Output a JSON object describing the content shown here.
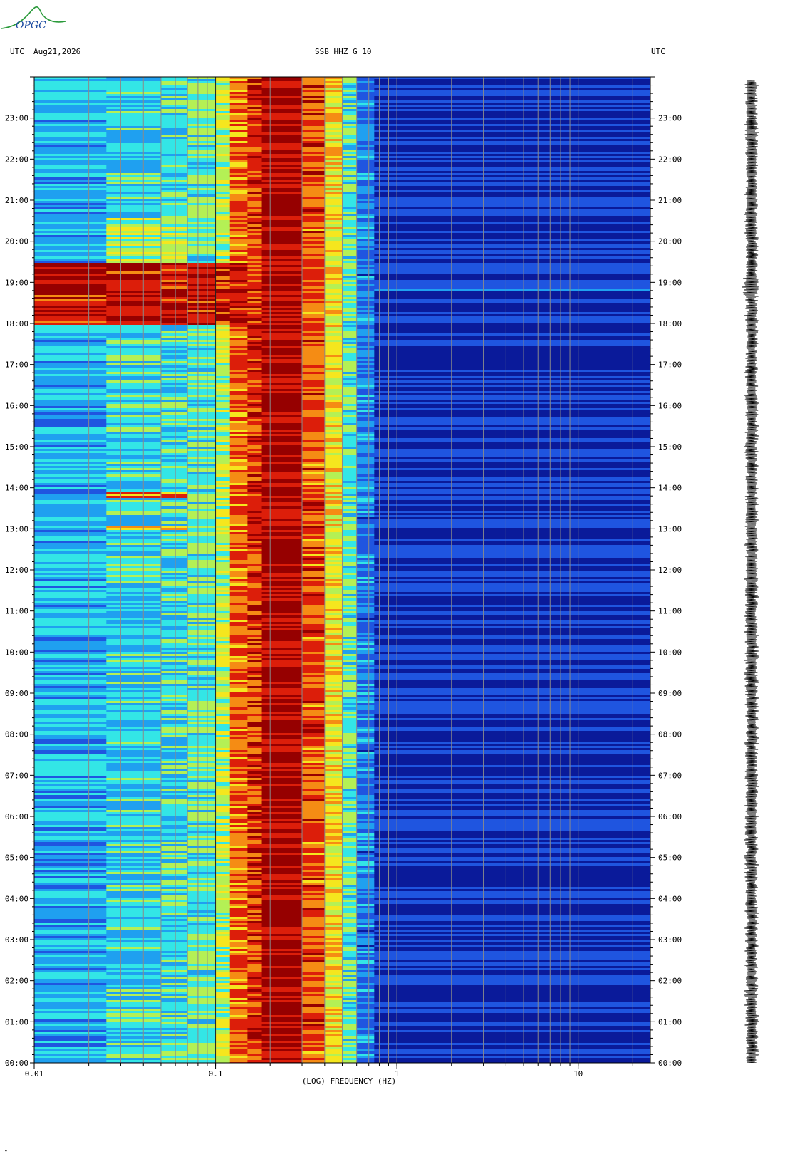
{
  "header": {
    "left_utc": "UTC",
    "date": "Aug21,2026",
    "center": "SSB HHZ G 10",
    "right_utc": "UTC"
  },
  "logo": {
    "text": "OPGC"
  },
  "footer": {
    "mark": "\""
  },
  "chart_data": {
    "type": "heatmap",
    "title": "",
    "xlabel": "(LOG) FREQUENCY (HZ)",
    "ylabel": "",
    "x_scale": "log",
    "xlim": [
      0.01,
      25
    ],
    "ylim": [
      "00:00",
      "24:00"
    ],
    "x_ticks": [
      {
        "value": 0.01,
        "label": "0.01"
      },
      {
        "value": 0.1,
        "label": "0.1"
      },
      {
        "value": 1,
        "label": "1"
      },
      {
        "value": 10,
        "label": "10"
      }
    ],
    "y_ticks": [
      "00:00",
      "01:00",
      "02:00",
      "03:00",
      "04:00",
      "05:00",
      "06:00",
      "07:00",
      "08:00",
      "09:00",
      "10:00",
      "11:00",
      "12:00",
      "13:00",
      "14:00",
      "15:00",
      "16:00",
      "17:00",
      "18:00",
      "19:00",
      "20:00",
      "21:00",
      "22:00",
      "23:00"
    ],
    "gridlines_hz": [
      0.02,
      0.03,
      0.04,
      0.05,
      0.06,
      0.07,
      0.08,
      0.09,
      0.1,
      0.2,
      0.3,
      0.4,
      0.5,
      0.6,
      0.7,
      0.8,
      0.9,
      1,
      2,
      3,
      4,
      5,
      6,
      7,
      8,
      9,
      10,
      20
    ],
    "colormap": [
      "#0a1a9a",
      "#1f55e0",
      "#1fa0f0",
      "#33e6e6",
      "#b4f055",
      "#f5e61e",
      "#f58c14",
      "#dc1e0a",
      "#960000"
    ],
    "grid": true,
    "bands_hz": [
      {
        "f0": 0.01,
        "f1": 0.025,
        "level": 0.28
      },
      {
        "f0": 0.025,
        "f1": 0.05,
        "level": 0.34
      },
      {
        "f0": 0.05,
        "f1": 0.07,
        "level": 0.37
      },
      {
        "f0": 0.07,
        "f1": 0.1,
        "level": 0.42
      },
      {
        "f0": 0.1,
        "f1": 0.12,
        "level": 0.52
      },
      {
        "f0": 0.12,
        "f1": 0.15,
        "level": 0.78
      },
      {
        "f0": 0.15,
        "f1": 0.18,
        "level": 0.86
      },
      {
        "f0": 0.18,
        "f1": 0.3,
        "level": 0.97
      },
      {
        "f0": 0.3,
        "f1": 0.4,
        "level": 0.82
      },
      {
        "f0": 0.4,
        "f1": 0.5,
        "level": 0.62
      },
      {
        "f0": 0.5,
        "f1": 0.6,
        "level": 0.42
      },
      {
        "f0": 0.6,
        "f1": 0.75,
        "level": 0.2
      },
      {
        "f0": 0.75,
        "f1": 25,
        "level": 0.05
      }
    ],
    "events": [
      {
        "t0": 18.0,
        "t1": 19.5,
        "f0": 0.01,
        "f1": 0.1,
        "level": 0.92
      },
      {
        "t0": 18.0,
        "t1": 19.5,
        "f0": 0.1,
        "f1": 0.15,
        "level": 0.9
      },
      {
        "t0": 19.5,
        "t1": 20.6,
        "f0": 0.025,
        "f1": 0.07,
        "level": 0.5
      },
      {
        "t0": 13.0,
        "t1": 13.12,
        "f0": 0.025,
        "f1": 0.07,
        "level": 0.72
      },
      {
        "t0": 13.8,
        "t1": 13.95,
        "f0": 0.025,
        "f1": 0.07,
        "level": 0.75
      }
    ],
    "seismogram": {
      "burst_hour": 19.0
    }
  }
}
